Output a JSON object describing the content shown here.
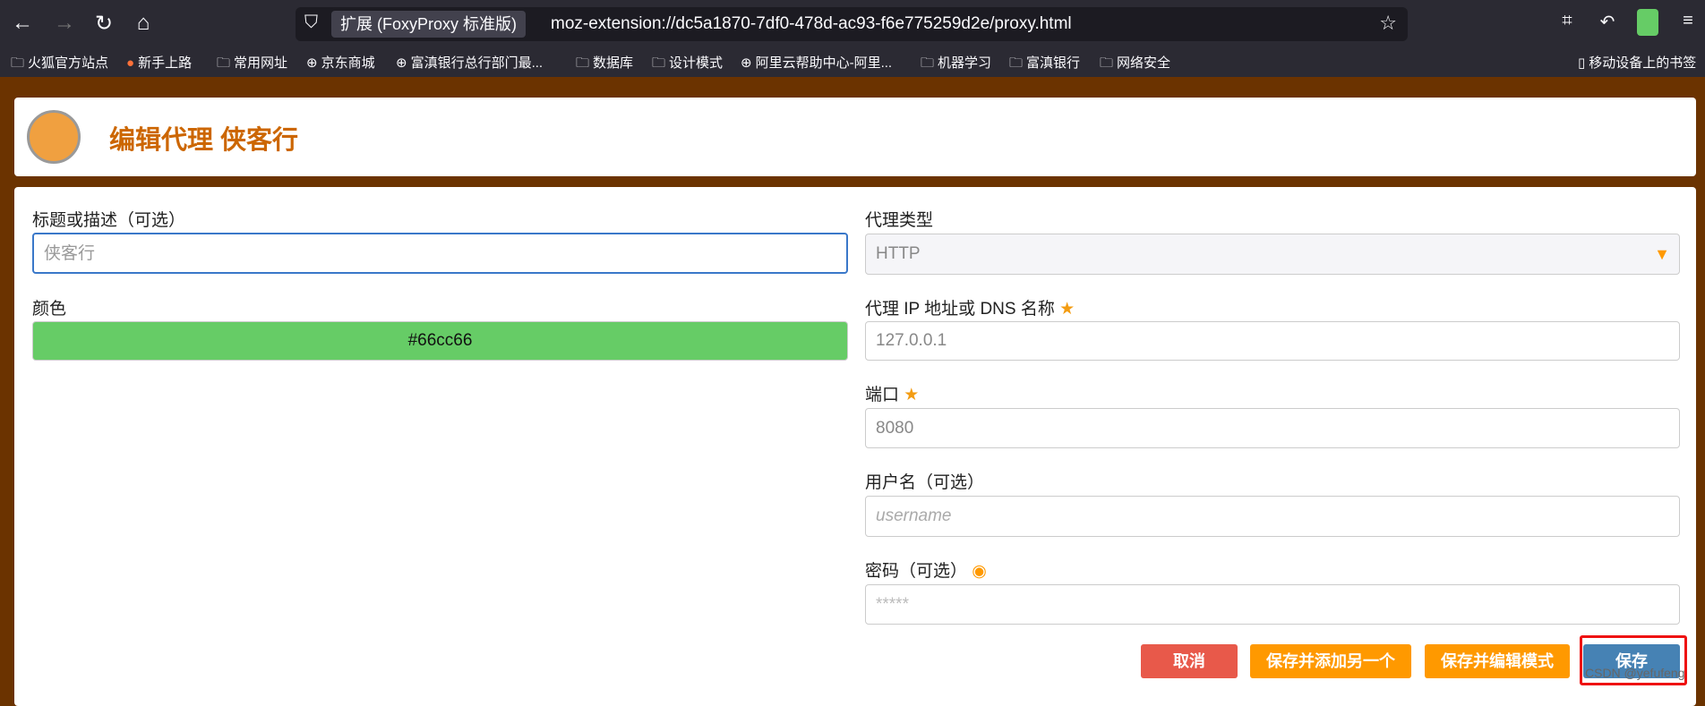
{
  "browser": {
    "extension_chip": "扩展 (FoxyProxy 标准版)",
    "url": "moz-extension://dc5a1870-7df0-478d-ac93-f6e775259d2e/proxy.html",
    "bookmarks": [
      "火狐官方站点",
      "新手上路",
      "常用网址",
      "京东商城",
      "富滇银行总行部门最...",
      "数据库",
      "设计模式",
      "阿里云帮助中心-阿里...",
      "机器学习",
      "富滇银行",
      "网络安全"
    ],
    "mobile_bookmarks": "移动设备上的书签"
  },
  "header": {
    "title": "编辑代理 侠客行"
  },
  "form": {
    "title_label": "标题或描述（可选）",
    "title_value": "侠客行",
    "color_label": "颜色",
    "color_value": "#66cc66",
    "type_label": "代理类型",
    "type_value": "HTTP",
    "host_label": "代理 IP 地址或 DNS 名称",
    "host_value": "127.0.0.1",
    "port_label": "端口",
    "port_value": "8080",
    "username_label": "用户名（可选）",
    "username_placeholder": "username",
    "password_label": "密码（可选）",
    "password_placeholder": "*****"
  },
  "buttons": {
    "cancel": "取消",
    "save_add": "保存并添加另一个",
    "save_edit": "保存并编辑模式",
    "save": "保存"
  },
  "watermark": "CSDN @yefufeng",
  "colors": {
    "accent": "#cc6600",
    "background": "#6b3300",
    "save": "#4682b4",
    "cancel": "#e8594a",
    "orange": "#ff9900"
  }
}
